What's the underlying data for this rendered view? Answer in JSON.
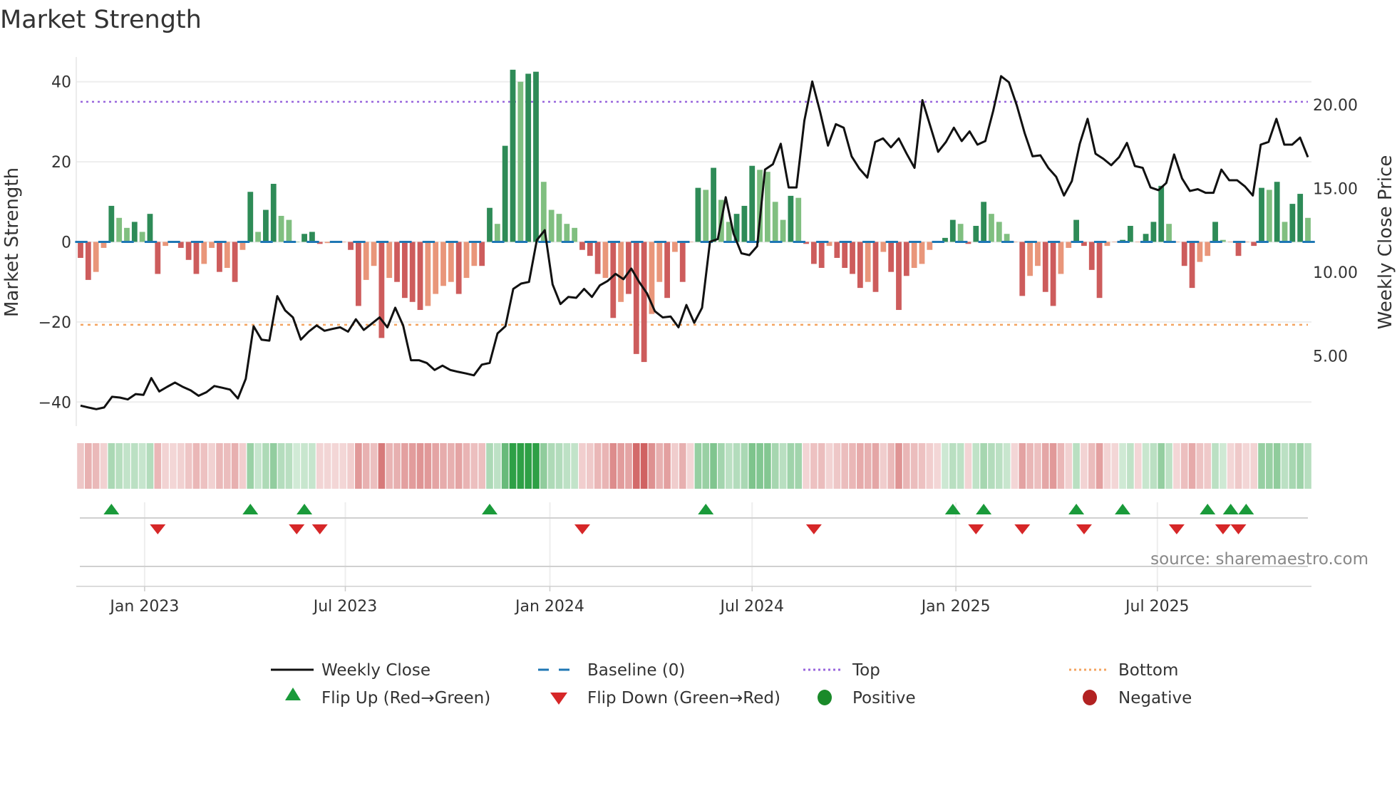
{
  "title": "Market Strength",
  "source": "source: sharemaestro.com",
  "colors": {
    "strong_green": "#2e8b57",
    "weak_green": "#80bf80",
    "strong_red": "#cd5c5c",
    "weak_red": "#e9967a",
    "baseline": "#1f77b4",
    "top": "#9966dd",
    "bottom": "#f4a460",
    "flip_up": "#1a9a3a",
    "flip_down": "#d62728",
    "positive": "#1a8a2a",
    "negative": "#b22222"
  },
  "chart_data": {
    "type": "bar+line",
    "title": "Market Strength",
    "ylabel": "Market Strength",
    "y2label": "Weekly Close Price",
    "ylim": [
      -46,
      46
    ],
    "y2lim": [
      0.8,
      22.8
    ],
    "yticks": [
      "40",
      "20",
      "0",
      "−20",
      "−40"
    ],
    "ytick_values": [
      40,
      20,
      0,
      -20,
      -40
    ],
    "y2ticks": [
      "20.00",
      "15.00",
      "10.00",
      "5.00"
    ],
    "y2tick_values": [
      20,
      15,
      10,
      5
    ],
    "xticks": [
      "Jan 2023",
      "Jul 2023",
      "Jan 2024",
      "Jul 2024",
      "Jan 2025",
      "Jul 2025"
    ],
    "xtick_week_index": [
      8.3,
      34.3,
      60.8,
      87.0,
      113.4,
      139.5
    ],
    "top_level": 35,
    "bottom_level": -20.7,
    "baseline": 0,
    "strength": [
      [
        -4,
        "R"
      ],
      [
        -9.5,
        "R"
      ],
      [
        -7.5,
        "r"
      ],
      [
        -1.5,
        "r"
      ],
      [
        9,
        "G"
      ],
      [
        6,
        "g"
      ],
      [
        3.5,
        "g"
      ],
      [
        5,
        "G"
      ],
      [
        2.5,
        "g"
      ],
      [
        7,
        "G"
      ],
      [
        -8,
        "R"
      ],
      [
        -1,
        "r"
      ],
      [
        0,
        "r"
      ],
      [
        -1.5,
        "R"
      ],
      [
        -4.5,
        "R"
      ],
      [
        -8,
        "R"
      ],
      [
        -5.5,
        "r"
      ],
      [
        -1.5,
        "r"
      ],
      [
        -7.5,
        "R"
      ],
      [
        -6.5,
        "r"
      ],
      [
        -10,
        "R"
      ],
      [
        -2,
        "r"
      ],
      [
        12.5,
        "G"
      ],
      [
        2.5,
        "g"
      ],
      [
        8,
        "G"
      ],
      [
        14.5,
        "G"
      ],
      [
        6.5,
        "g"
      ],
      [
        5.5,
        "g"
      ],
      [
        0,
        "g"
      ],
      [
        2,
        "G"
      ],
      [
        2.5,
        "G"
      ],
      [
        -0.5,
        "R"
      ],
      [
        -0.3,
        "r"
      ],
      [
        0,
        "r"
      ],
      [
        0,
        "r"
      ],
      [
        -2,
        "R"
      ],
      [
        -16,
        "R"
      ],
      [
        -9.5,
        "r"
      ],
      [
        -6,
        "r"
      ],
      [
        -24,
        "R"
      ],
      [
        -9,
        "r"
      ],
      [
        -10,
        "R"
      ],
      [
        -14,
        "R"
      ],
      [
        -15,
        "R"
      ],
      [
        -17,
        "R"
      ],
      [
        -16,
        "r"
      ],
      [
        -13,
        "r"
      ],
      [
        -11,
        "r"
      ],
      [
        -10,
        "r"
      ],
      [
        -13,
        "R"
      ],
      [
        -9,
        "r"
      ],
      [
        -6,
        "r"
      ],
      [
        -6,
        "R"
      ],
      [
        8.5,
        "G"
      ],
      [
        4.5,
        "g"
      ],
      [
        24,
        "G"
      ],
      [
        43,
        "G"
      ],
      [
        40,
        "g"
      ],
      [
        42,
        "G"
      ],
      [
        42.5,
        "G"
      ],
      [
        15,
        "g"
      ],
      [
        8,
        "g"
      ],
      [
        7,
        "g"
      ],
      [
        4.5,
        "g"
      ],
      [
        3.5,
        "g"
      ],
      [
        -2,
        "R"
      ],
      [
        -3.5,
        "R"
      ],
      [
        -8,
        "R"
      ],
      [
        -9,
        "r"
      ],
      [
        -19,
        "R"
      ],
      [
        -15,
        "r"
      ],
      [
        -13,
        "R"
      ],
      [
        -28,
        "R"
      ],
      [
        -30,
        "R"
      ],
      [
        -18,
        "r"
      ],
      [
        -10,
        "r"
      ],
      [
        -14,
        "R"
      ],
      [
        -2.5,
        "r"
      ],
      [
        -10,
        "R"
      ],
      [
        0,
        "r"
      ],
      [
        13.5,
        "G"
      ],
      [
        13,
        "g"
      ],
      [
        18.5,
        "G"
      ],
      [
        10.5,
        "g"
      ],
      [
        5,
        "g"
      ],
      [
        7,
        "G"
      ],
      [
        9,
        "G"
      ],
      [
        19,
        "G"
      ],
      [
        18,
        "g"
      ],
      [
        17.5,
        "g"
      ],
      [
        10,
        "g"
      ],
      [
        5.5,
        "g"
      ],
      [
        11.5,
        "G"
      ],
      [
        11,
        "g"
      ],
      [
        -0.5,
        "R"
      ],
      [
        -5.5,
        "R"
      ],
      [
        -6.5,
        "R"
      ],
      [
        -1,
        "r"
      ],
      [
        -4,
        "R"
      ],
      [
        -6.5,
        "R"
      ],
      [
        -8,
        "R"
      ],
      [
        -11.5,
        "R"
      ],
      [
        -10,
        "r"
      ],
      [
        -12.5,
        "R"
      ],
      [
        -2.5,
        "r"
      ],
      [
        -7.5,
        "R"
      ],
      [
        -17,
        "R"
      ],
      [
        -8.5,
        "R"
      ],
      [
        -6.5,
        "r"
      ],
      [
        -5.5,
        "r"
      ],
      [
        -2,
        "r"
      ],
      [
        0,
        "r"
      ],
      [
        1,
        "G"
      ],
      [
        5.5,
        "G"
      ],
      [
        4.5,
        "g"
      ],
      [
        -0.5,
        "R"
      ],
      [
        4,
        "G"
      ],
      [
        10,
        "G"
      ],
      [
        7,
        "g"
      ],
      [
        5,
        "g"
      ],
      [
        2,
        "g"
      ],
      [
        0,
        "r"
      ],
      [
        -13.5,
        "R"
      ],
      [
        -8.5,
        "r"
      ],
      [
        -6,
        "r"
      ],
      [
        -12.5,
        "R"
      ],
      [
        -16,
        "R"
      ],
      [
        -8,
        "r"
      ],
      [
        -1.5,
        "r"
      ],
      [
        5.5,
        "G"
      ],
      [
        -1,
        "R"
      ],
      [
        -7,
        "R"
      ],
      [
        -14,
        "R"
      ],
      [
        -1,
        "r"
      ],
      [
        0,
        "r"
      ],
      [
        0.5,
        "G"
      ],
      [
        4,
        "G"
      ],
      [
        0,
        "r"
      ],
      [
        2,
        "G"
      ],
      [
        5,
        "G"
      ],
      [
        14,
        "G"
      ],
      [
        4.5,
        "g"
      ],
      [
        0,
        "r"
      ],
      [
        -6,
        "R"
      ],
      [
        -11.5,
        "R"
      ],
      [
        -5,
        "r"
      ],
      [
        -3.5,
        "r"
      ],
      [
        5,
        "G"
      ],
      [
        0.5,
        "g"
      ],
      [
        0,
        "r"
      ],
      [
        -3.5,
        "R"
      ],
      [
        0,
        "r"
      ],
      [
        -1,
        "R"
      ],
      [
        13.5,
        "G"
      ],
      [
        13,
        "g"
      ],
      [
        15,
        "G"
      ],
      [
        5,
        "g"
      ],
      [
        9.5,
        "G"
      ],
      [
        12,
        "G"
      ],
      [
        6,
        "g"
      ]
    ],
    "weekly_close": [
      2.02,
      1.91,
      1.81,
      1.91,
      2.55,
      2.5,
      2.39,
      2.71,
      2.66,
      3.67,
      2.87,
      3.14,
      3.4,
      3.14,
      2.93,
      2.61,
      2.82,
      3.19,
      3.09,
      2.98,
      2.45,
      3.62,
      6.76,
      5.96,
      5.9,
      8.56,
      7.71,
      7.29,
      5.96,
      6.44,
      6.81,
      6.49,
      6.6,
      6.7,
      6.44,
      7.18,
      6.54,
      6.91,
      7.29,
      6.7,
      7.87,
      6.81,
      4.73,
      4.73,
      4.57,
      4.15,
      4.41,
      4.15,
      4.04,
      3.94,
      3.83,
      4.47,
      4.57,
      6.33,
      6.76,
      8.99,
      9.31,
      9.41,
      11.91,
      12.5,
      9.26,
      8.09,
      8.51,
      8.46,
      8.99,
      8.51,
      9.2,
      9.47,
      9.89,
      9.57,
      10.21,
      9.41,
      8.72,
      7.66,
      7.29,
      7.34,
      6.7,
      8.03,
      6.97,
      7.87,
      11.81,
      11.97,
      14.47,
      12.29,
      11.12,
      11.01,
      11.54,
      16.12,
      16.44,
      17.66,
      15.05,
      15.05,
      19.04,
      21.38,
      19.57,
      17.55,
      18.83,
      18.62,
      16.91,
      16.17,
      15.64,
      17.77,
      17.98,
      17.45,
      17.98,
      17.07,
      16.22,
      20.27,
      18.72,
      17.18,
      17.77,
      18.62,
      17.82,
      18.4,
      17.61,
      17.82,
      19.63,
      21.7,
      21.33,
      19.95,
      18.3,
      16.91,
      16.97,
      16.22,
      15.69,
      14.57,
      15.43,
      17.66,
      19.15,
      17.07,
      16.76,
      16.38,
      16.86,
      17.71,
      16.33,
      16.22,
      15.05,
      14.89,
      15.32,
      17.02,
      15.59,
      14.84,
      14.95,
      14.73,
      14.73,
      16.12,
      15.48,
      15.48,
      15.11,
      14.57,
      17.61,
      17.77,
      19.15,
      17.61,
      17.61,
      18.03,
      16.86
    ],
    "flip_up_week_index": [
      4,
      22,
      29,
      53,
      81,
      113,
      117,
      129,
      135,
      146,
      149,
      151
    ],
    "flip_down_week_index": [
      10,
      28,
      31,
      65,
      95,
      116,
      122,
      130,
      142,
      148,
      150
    ],
    "legend": {
      "placement": "bottom",
      "items": [
        "Weekly Close",
        "Baseline (0)",
        "Top",
        "Bottom",
        "Flip Up (Red→Green)",
        "Flip Down (Green→Red)",
        "Positive",
        "Negative"
      ]
    }
  }
}
